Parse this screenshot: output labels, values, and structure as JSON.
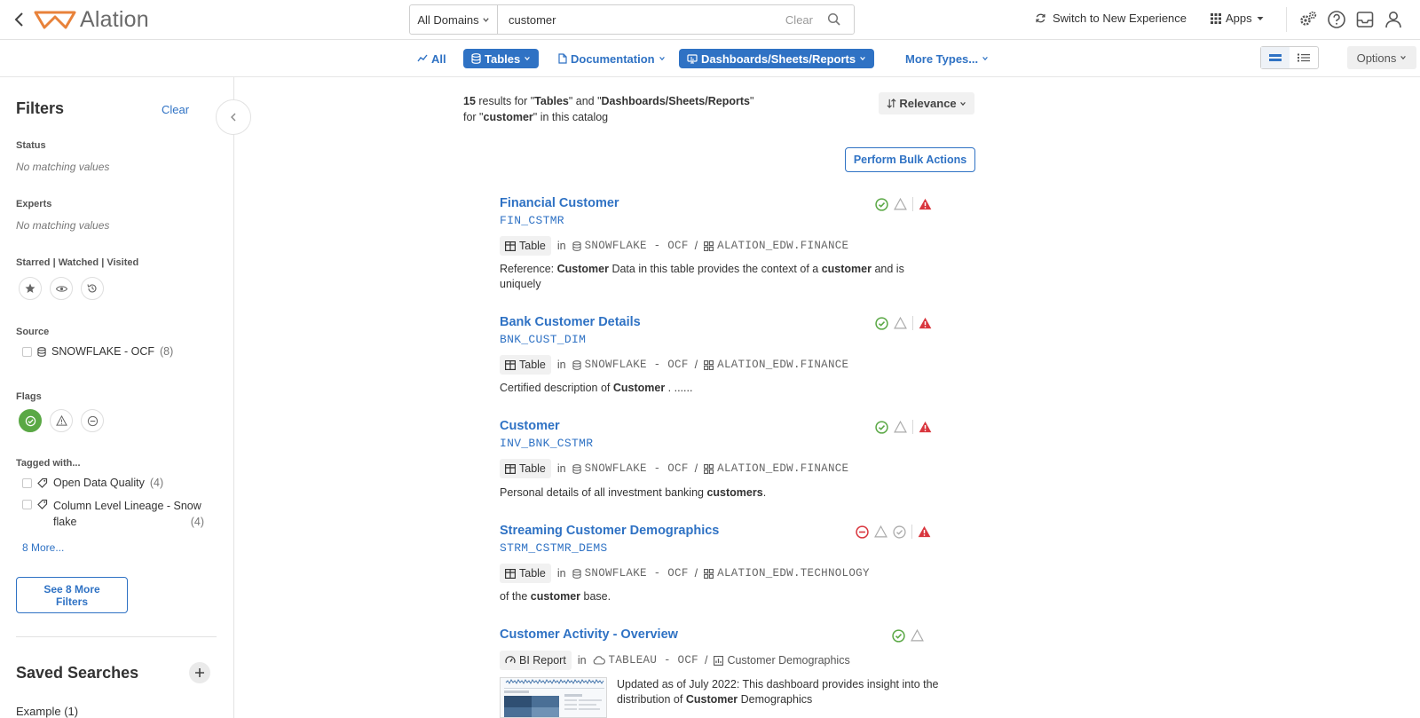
{
  "header": {
    "logo_text": "Alation",
    "domains_label": "All Domains",
    "search_value": "customer",
    "search_placeholder": "Search",
    "clear_label": "Clear",
    "switch_label": "Switch to New Experience",
    "apps_label": "Apps"
  },
  "typebar": {
    "all": "All",
    "tables": "Tables",
    "documentation": "Documentation",
    "dashboards": "Dashboards/Sheets/Reports",
    "more_types": "More Types...",
    "options": "Options"
  },
  "filters": {
    "title": "Filters",
    "clear": "Clear",
    "status_label": "Status",
    "status_empty": "No matching values",
    "experts_label": "Experts",
    "experts_empty": "No matching values",
    "swv_label": "Starred | Watched | Visited",
    "source_label": "Source",
    "source_items": [
      {
        "label": "SNOWFLAKE - OCF",
        "count": "(8)"
      }
    ],
    "flags_label": "Flags",
    "tagged_label": "Tagged with...",
    "tag_items": [
      {
        "label": "Open Data Quality",
        "count": "(4)"
      },
      {
        "label_line1": "Column Level Lineage - Snow",
        "label_line2": "flake",
        "count": "(4)"
      }
    ],
    "more_link": "8 More...",
    "see_more_line1": "See 8 More",
    "see_more_line2": "Filters"
  },
  "saved": {
    "title": "Saved Searches",
    "items": [
      {
        "label": "Example (1)"
      }
    ]
  },
  "summary": {
    "count": "15",
    "t1": " results for \"",
    "type1": "Tables",
    "t2": "\" and \"",
    "type2": "Dashboards/Sheets/Reports",
    "t3": "\"",
    "t4": " for \"",
    "query": "customer",
    "t5": "\" in this catalog"
  },
  "relevance_label": "Relevance",
  "bulk_label": "Perform Bulk Actions",
  "common": {
    "in": "in",
    "slash": "/"
  },
  "results": [
    {
      "title": "Financial Customer",
      "sub": "FIN_CSTMR",
      "type": "Table",
      "source": "SNOWFLAKE - OCF",
      "schema": "ALATION_EDW.FINANCE",
      "desc": {
        "a": "Reference:  ",
        "b": "Customer",
        "c": "   Data in this table provides the context of a ",
        "d": "customer",
        "e": " and is uniquely"
      }
    },
    {
      "title": "Bank Customer Details",
      "sub": "BNK_CUST_DIM",
      "type": "Table",
      "source": "SNOWFLAKE - OCF",
      "schema": "ALATION_EDW.FINANCE",
      "desc": {
        "a": "Certified description of ",
        "b": "Customer",
        "c": "  . ......"
      }
    },
    {
      "title": "Customer",
      "sub": "INV_BNK_CSTMR",
      "type": "Table",
      "source": "SNOWFLAKE - OCF",
      "schema": "ALATION_EDW.FINANCE",
      "desc": {
        "a": "Personal details of all investment banking ",
        "b": "customers",
        "c": "."
      }
    },
    {
      "title": "Streaming Customer Demographics",
      "sub": "STRM_CSTMR_DEMS",
      "type": "Table",
      "source": "SNOWFLAKE - OCF",
      "schema": "ALATION_EDW.TECHNOLOGY",
      "desc": {
        "a": "of the ",
        "b": "customer",
        "c": " base."
      }
    },
    {
      "title": "Customer Activity - Overview",
      "type": "BI Report",
      "source": "TABLEAU - OCF",
      "schema": "Customer Demographics",
      "desc": {
        "a": "Updated as of July 2022: This dashboard provides insight into the distribution of ",
        "b": "Customer",
        "c": " Demographics"
      }
    }
  ],
  "colors": {
    "accent": "#2f72c4",
    "green": "#5aa845",
    "red": "#d9363e",
    "logo_orange": "#e8823a"
  }
}
